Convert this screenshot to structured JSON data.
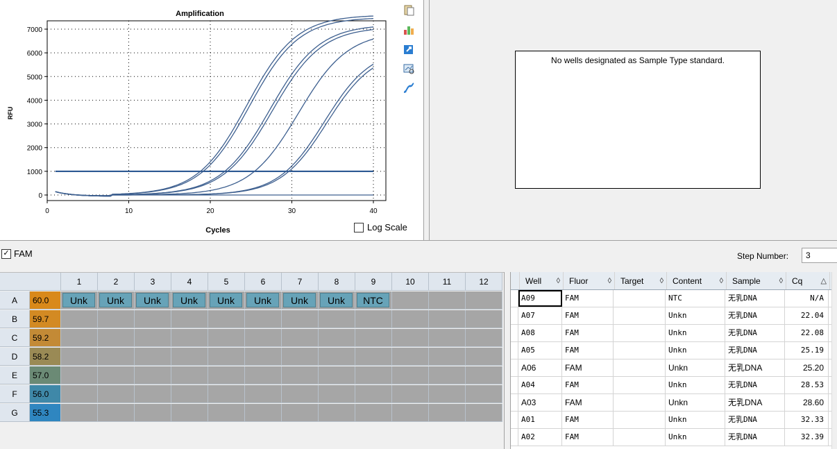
{
  "chart": {
    "chart_data": {
      "type": "line",
      "title": "Amplification",
      "xlabel": "Cycles",
      "ylabel": "RFU",
      "xlim": [
        0,
        40
      ],
      "ylim": [
        0,
        7000
      ],
      "x_ticks": [
        "0",
        "10",
        "20",
        "30",
        "40"
      ],
      "y_ticks": [
        "0",
        "1000",
        "2000",
        "3000",
        "4000",
        "5000",
        "6000",
        "7000"
      ],
      "grid": "dotted",
      "threshold": 1000,
      "series": [
        {
          "midpoint": 24.5,
          "plateau": 7600,
          "slope": 0.33
        },
        {
          "midpoint": 24.8,
          "plateau": 7500,
          "slope": 0.33
        },
        {
          "midpoint": 27.3,
          "plateau": 7200,
          "slope": 0.33
        },
        {
          "midpoint": 27.6,
          "plateau": 7100,
          "slope": 0.33
        },
        {
          "midpoint": 30.8,
          "plateau": 6900,
          "slope": 0.33
        },
        {
          "midpoint": 34.0,
          "plateau": 6200,
          "slope": 0.35
        },
        {
          "midpoint": 34.3,
          "plateau": 6100,
          "slope": 0.35
        },
        {
          "midpoint": 99,
          "plateau": 0,
          "slope": 0.3
        }
      ]
    },
    "log_scale_label": "Log Scale"
  },
  "standard_panel": {
    "message": "No wells designated as Sample Type standard."
  },
  "fluor_bar": {
    "fam_label": "FAM",
    "step_label": "Step Number:",
    "step_value": "3"
  },
  "plate": {
    "columns": [
      "1",
      "2",
      "3",
      "4",
      "5",
      "6",
      "7",
      "8",
      "9",
      "10",
      "11",
      "12"
    ],
    "rows": [
      {
        "label": "A",
        "temp": "60.0",
        "color": "#d9891a",
        "wells": [
          "Unk",
          "Unk",
          "Unk",
          "Unk",
          "Unk",
          "Unk",
          "Unk",
          "Unk",
          "NTC",
          "",
          "",
          ""
        ]
      },
      {
        "label": "B",
        "temp": "59.7",
        "color": "#d38a23",
        "wells": [
          "",
          "",
          "",
          "",
          "",
          "",
          "",
          "",
          "",
          "",
          "",
          ""
        ]
      },
      {
        "label": "C",
        "temp": "59.2",
        "color": "#c38a36",
        "wells": [
          "",
          "",
          "",
          "",
          "",
          "",
          "",
          "",
          "",
          "",
          "",
          ""
        ]
      },
      {
        "label": "D",
        "temp": "58.2",
        "color": "#9a8a55",
        "wells": [
          "",
          "",
          "",
          "",
          "",
          "",
          "",
          "",
          "",
          "",
          "",
          ""
        ]
      },
      {
        "label": "E",
        "temp": "57.0",
        "color": "#6b8a75",
        "wells": [
          "",
          "",
          "",
          "",
          "",
          "",
          "",
          "",
          "",
          "",
          "",
          ""
        ]
      },
      {
        "label": "F",
        "temp": "56.0",
        "color": "#3f88a8",
        "wells": [
          "",
          "",
          "",
          "",
          "",
          "",
          "",
          "",
          "",
          "",
          "",
          ""
        ]
      },
      {
        "label": "G",
        "temp": "55.3",
        "color": "#2f86c0",
        "wells": [
          "",
          "",
          "",
          "",
          "",
          "",
          "",
          "",
          "",
          "",
          "",
          ""
        ]
      }
    ]
  },
  "results": {
    "headers": [
      "Well",
      "Fluor",
      "Target",
      "Content",
      "Sample",
      "Cq"
    ],
    "header_glyphs": [
      "◊",
      "◊",
      "◊",
      "◊",
      "◊",
      "△"
    ],
    "rows": [
      {
        "well": "A09",
        "fluor": "FAM",
        "target": "",
        "content": "NTC",
        "sample": "无乳DNA",
        "cq": "N/A"
      },
      {
        "well": "A07",
        "fluor": "FAM",
        "target": "",
        "content": "Unkn",
        "sample": "无乳DNA",
        "cq": "22.04"
      },
      {
        "well": "A08",
        "fluor": "FAM",
        "target": "",
        "content": "Unkn",
        "sample": "无乳DNA",
        "cq": "22.08"
      },
      {
        "well": "A05",
        "fluor": "FAM",
        "target": "",
        "content": "Unkn",
        "sample": "无乳DNA",
        "cq": "25.19"
      },
      {
        "well": "A06",
        "fluor": "FAM",
        "target": "",
        "content": "Unkn",
        "sample": "无乳DNA",
        "cq": "25.20"
      },
      {
        "well": "A04",
        "fluor": "FAM",
        "target": "",
        "content": "Unkn",
        "sample": "无乳DNA",
        "cq": "28.53"
      },
      {
        "well": "A03",
        "fluor": "FAM",
        "target": "",
        "content": "Unkn",
        "sample": "无乳DNA",
        "cq": "28.60"
      },
      {
        "well": "A01",
        "fluor": "FAM",
        "target": "",
        "content": "Unkn",
        "sample": "无乳DNA",
        "cq": "32.33"
      },
      {
        "well": "A02",
        "fluor": "FAM",
        "target": "",
        "content": "Unkn",
        "sample": "无乳DNA",
        "cq": "32.39"
      }
    ]
  }
}
